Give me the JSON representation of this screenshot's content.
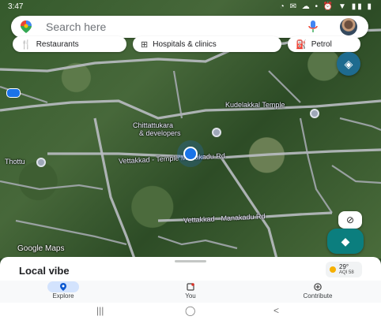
{
  "status_bar": {
    "time": "3:47",
    "icons": "◔ ✉ ☁ •   ⏰ ▼ ▮▮ ▮"
  },
  "search": {
    "placeholder": "Search here"
  },
  "chips": [
    {
      "label": "Restaurants",
      "icon": "fork-knife-icon"
    },
    {
      "label": "Hospitals & clinics",
      "icon": "hospital-icon"
    },
    {
      "label": "Petrol",
      "icon": "fuel-icon"
    }
  ],
  "map": {
    "labels": {
      "place_1": "Chittattukara",
      "place_1_sub": "& developers",
      "place_2": "Kudelakkal Temple",
      "road_1": "Vettakkad - Temple Manakadu Rd",
      "road_2": "Vettakkad - Manakadu Rd",
      "small_left": "Thottu",
      "attribution": "Google Maps"
    },
    "current_location_color": "#1a73e8"
  },
  "sheet": {
    "title": "Local vibe",
    "weather_temp": "29°",
    "weather_aqi": "AQI 58"
  },
  "nav": {
    "items": [
      {
        "label": "Explore",
        "icon": "explore-pin-icon",
        "active": true
      },
      {
        "label": "You",
        "icon": "you-bookmark-icon",
        "active": false
      },
      {
        "label": "Contribute",
        "icon": "contribute-plus-icon",
        "active": false
      }
    ]
  },
  "system_nav": {
    "recents": "|||",
    "home": "◯",
    "back": "<"
  }
}
